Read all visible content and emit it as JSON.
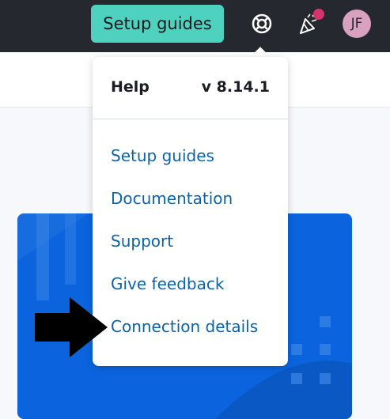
{
  "header": {
    "setup_button_label": "Setup guides",
    "help_icon": "lifebuoy-icon",
    "news_icon": "party-popper-icon",
    "avatar_initials": "JF"
  },
  "help_menu": {
    "title": "Help",
    "version": "v 8.14.1",
    "links": [
      "Setup guides",
      "Documentation",
      "Support",
      "Give feedback",
      "Connection details"
    ]
  },
  "colors": {
    "topbar": "#25282f",
    "setup_button": "#4fd1bf",
    "link": "#0b64aa",
    "card_blue": "#0b64dd",
    "notification_dot": "#d6336c",
    "avatar": "#d9a1c0"
  }
}
